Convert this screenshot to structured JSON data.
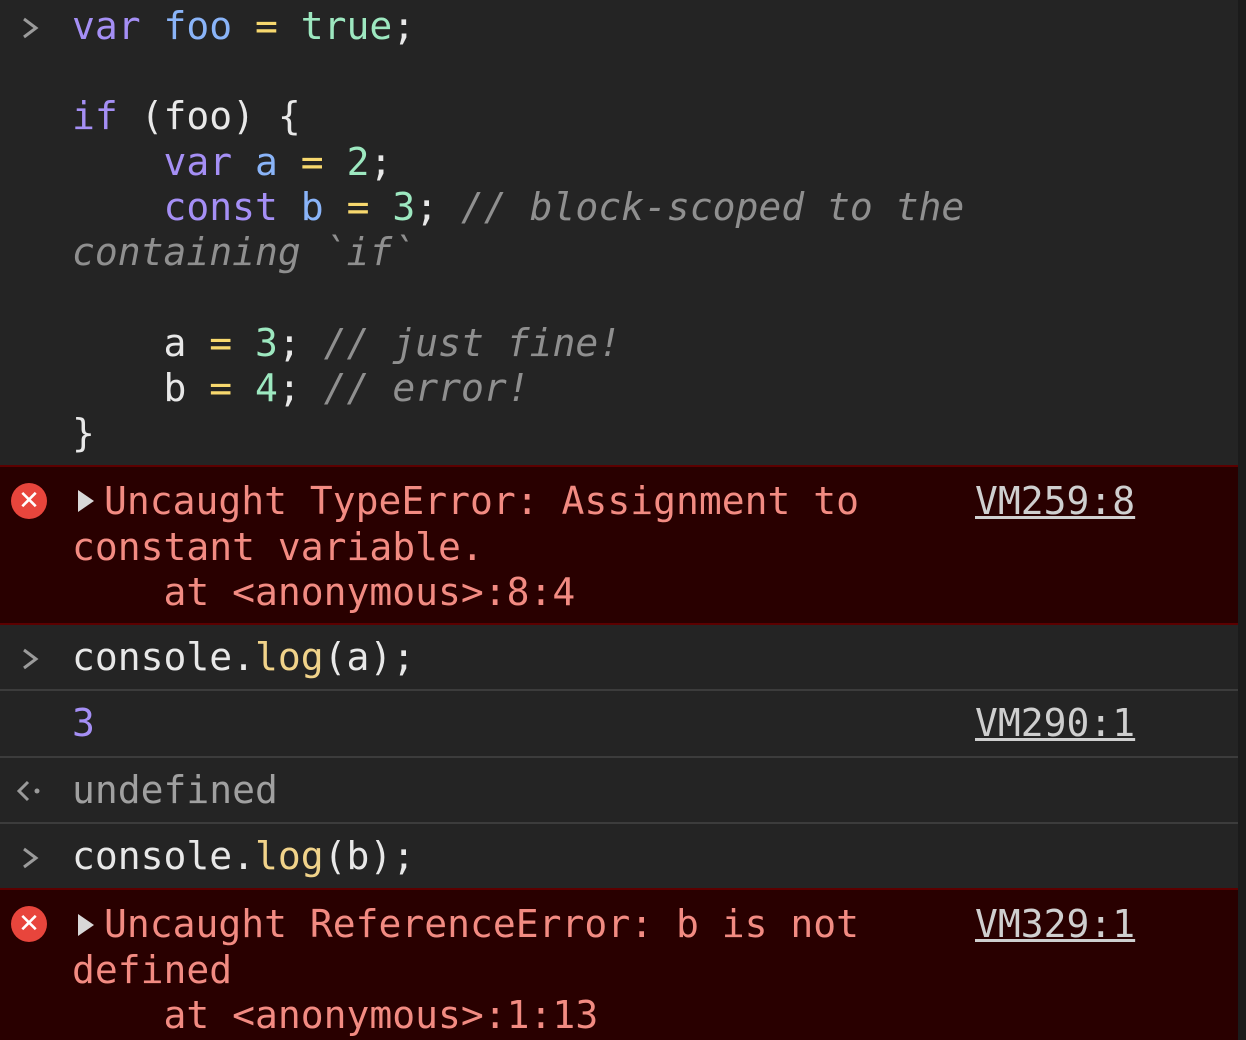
{
  "input_1": {
    "lines": [
      [
        [
          "kw",
          "var "
        ],
        [
          "var",
          "foo "
        ],
        [
          "op",
          "= "
        ],
        [
          "lit",
          "true"
        ],
        [
          "plain",
          ";"
        ]
      ],
      [],
      [
        [
          "kw",
          "if "
        ],
        [
          "plain",
          "(foo) {"
        ]
      ],
      [
        [
          "plain",
          "    "
        ],
        [
          "kw",
          "var "
        ],
        [
          "var",
          "a "
        ],
        [
          "op",
          "= "
        ],
        [
          "num",
          "2"
        ],
        [
          "plain",
          ";"
        ]
      ],
      [
        [
          "plain",
          "    "
        ],
        [
          "kw",
          "const "
        ],
        [
          "var",
          "b "
        ],
        [
          "op",
          "= "
        ],
        [
          "num",
          "3"
        ],
        [
          "plain",
          "; "
        ],
        [
          "cmt",
          "// block-scoped to the"
        ]
      ],
      [
        [
          "cmt",
          "containing `if`"
        ]
      ],
      [],
      [
        [
          "plain",
          "    a "
        ],
        [
          "op",
          "= "
        ],
        [
          "num",
          "3"
        ],
        [
          "plain",
          "; "
        ],
        [
          "cmt",
          "// just fine!"
        ]
      ],
      [
        [
          "plain",
          "    b "
        ],
        [
          "op",
          "= "
        ],
        [
          "num",
          "4"
        ],
        [
          "plain",
          "; "
        ],
        [
          "cmt",
          "// error!"
        ]
      ],
      [
        [
          "plain",
          "}"
        ]
      ]
    ]
  },
  "error_1": {
    "line1": "Uncaught TypeError: Assignment to",
    "line2": "constant variable.",
    "line3": "    at <anonymous>:8:4",
    "source": "VM259:8"
  },
  "input_2": {
    "prefix": "console.",
    "method": "log",
    "suffix": "(a);"
  },
  "output_2": {
    "value": "3",
    "source": "VM290:1"
  },
  "return_2": {
    "value": "undefined"
  },
  "input_3": {
    "prefix": "console.",
    "method": "log",
    "suffix": "(b);"
  },
  "error_2": {
    "line1": "Uncaught ReferenceError: b is not",
    "line2": "defined",
    "line3": "    at <anonymous>:1:13",
    "source": "VM329:1"
  },
  "icons": {
    "prompt": "chevron-right-icon",
    "return": "return-arrow-icon",
    "error": "error-circle-icon",
    "expand": "triangle-right-icon"
  },
  "colors": {
    "background": "#242424",
    "error_background": "#290000",
    "error_text": "#f28b82",
    "keyword": "#a58ff5",
    "variable": "#8ab4f8",
    "operator": "#f7d86e",
    "number": "#9de8c0",
    "comment": "#8f8f8f"
  }
}
